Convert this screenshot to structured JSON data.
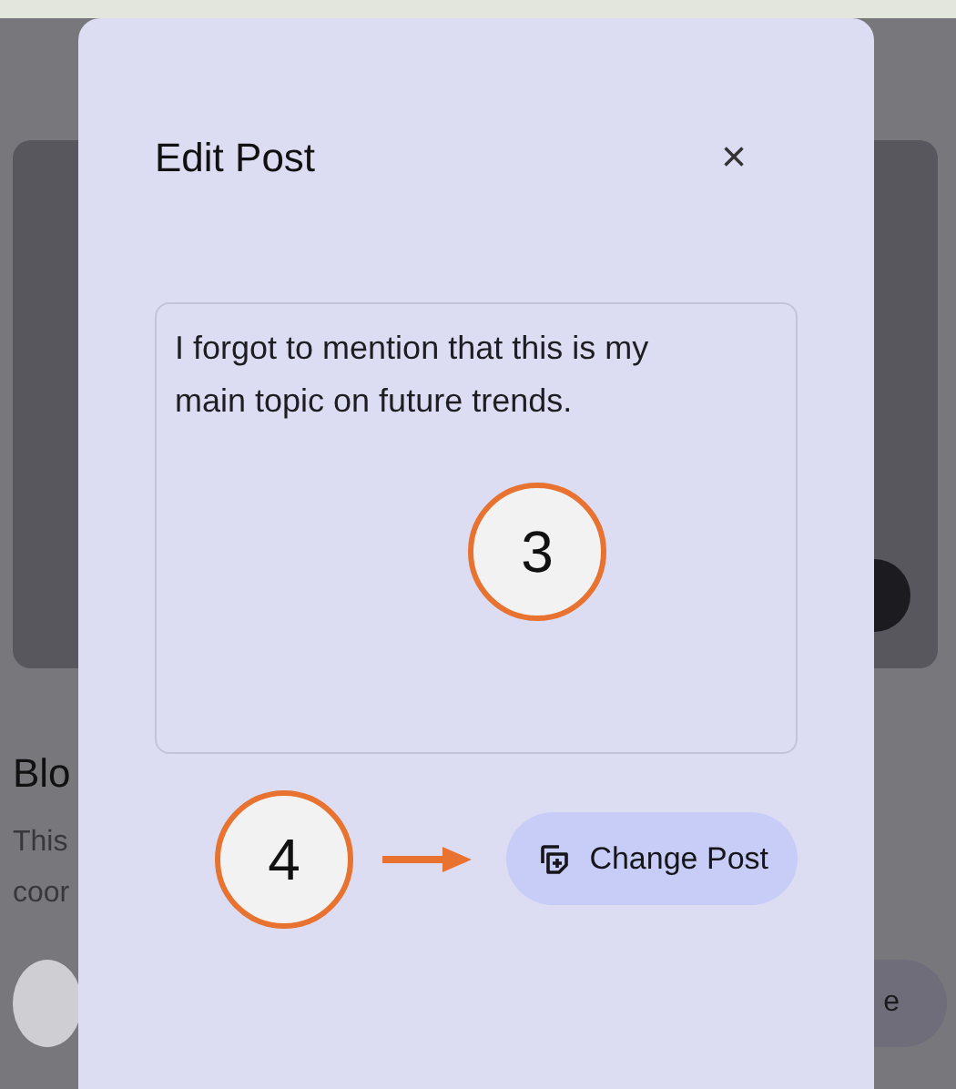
{
  "background": {
    "heading": "Blo",
    "text_lines": [
      "This",
      "coor"
    ],
    "button": "e"
  },
  "modal": {
    "title": "Edit Post",
    "close": "×",
    "post_text": "I forgot to mention that this is my main topic on future trends.",
    "button": "Change Post"
  },
  "annotations": [
    {
      "label": "3"
    },
    {
      "label": "4"
    }
  ]
}
